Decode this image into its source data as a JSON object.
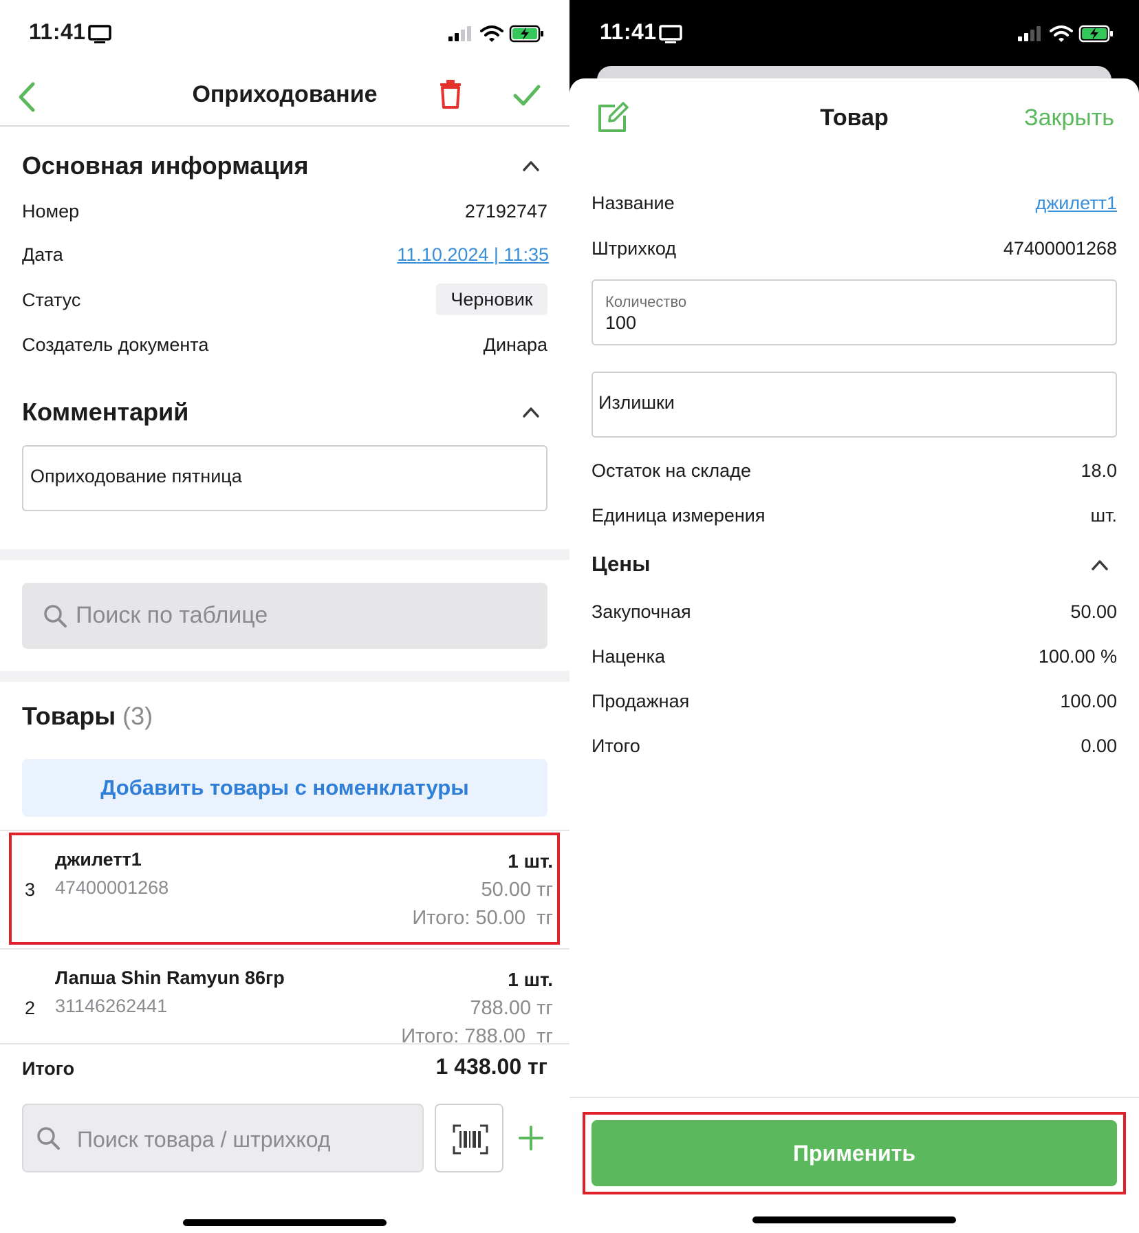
{
  "left": {
    "status": {
      "time": "11:41"
    },
    "header": {
      "title": "Оприходование"
    },
    "main_info": {
      "title": "Основная информация",
      "rows": [
        {
          "label": "Номер",
          "value": "27192747"
        },
        {
          "label": "Дата",
          "value": "11.10.2024 | 11:35"
        },
        {
          "label": "Статус",
          "value": "Черновик"
        },
        {
          "label": "Создатель документа",
          "value": "Динара"
        }
      ]
    },
    "comment": {
      "title": "Комментарий",
      "value": "Оприходование пятница"
    },
    "table_search": {
      "placeholder": "Поиск по таблице"
    },
    "products": {
      "title": "Товары",
      "count": "(3)",
      "add_button": "Добавить товары с номенклатуры",
      "items": [
        {
          "index": "3",
          "name": "джилетт1",
          "barcode": "47400001268",
          "qty": "1 шт.",
          "price": "50.00 тг",
          "total": "Итого: 50.00  тг"
        },
        {
          "index": "2",
          "name": "Лапша Shin Ramyun 86гр",
          "barcode": "31146262441",
          "qty": "1 шт.",
          "price": "788.00 тг",
          "total": "Итого: 788.00  тг"
        }
      ]
    },
    "footer": {
      "total_label": "Итого",
      "total_value": "1 438.00 тг",
      "search_placeholder": "Поиск товара / штрихкод"
    }
  },
  "right": {
    "status": {
      "time": "11:41"
    },
    "sheet": {
      "title": "Товар",
      "close": "Закрыть",
      "name_label": "Название",
      "name_value": "джилетт1",
      "barcode_label": "Штрихкод",
      "barcode_value": "47400001268",
      "qty_label": "Количество",
      "qty_value": "100",
      "reason_value": "Излишки",
      "stock_label": "Остаток на складе",
      "stock_value": "18.0",
      "unit_label": "Единица измерения",
      "unit_value": "шт.",
      "prices_title": "Цены",
      "prices": [
        {
          "label": "Закупочная",
          "value": "50.00"
        },
        {
          "label": "Наценка",
          "value": "100.00 %"
        },
        {
          "label": "Продажная",
          "value": "100.00"
        },
        {
          "label": "Итого",
          "value": "0.00"
        }
      ],
      "apply_button": "Применить"
    }
  },
  "colors": {
    "accent_green": "#5cb85c",
    "link_blue": "#3a8fd9",
    "danger_red": "#e5322d",
    "highlight_red": "#e0202a",
    "add_button_bg": "#eaf3fd",
    "add_button_text": "#2f7fd8"
  }
}
